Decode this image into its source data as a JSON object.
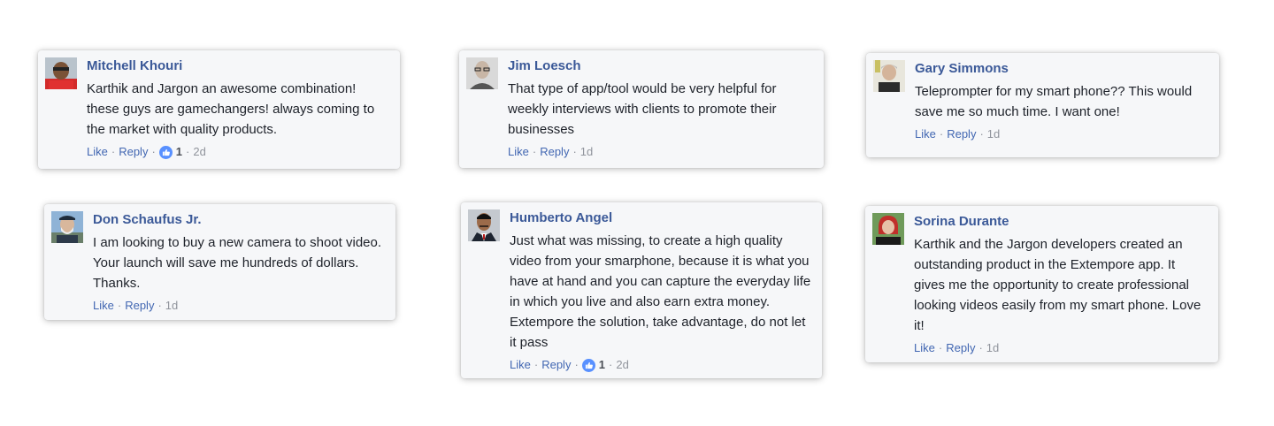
{
  "colors": {
    "name": "#3b5998",
    "link": "#4267b2",
    "meta": "#90949c",
    "like_badge": "#5890ff",
    "card_bg": "#f6f7f9"
  },
  "labels": {
    "like": "Like",
    "reply": "Reply",
    "sep": "·"
  },
  "comments": [
    {
      "name": "Mitchell Khouri",
      "text": "Karthik and Jargon an awesome combination! these guys are gamechangers! always coming to the market with quality products.",
      "likes": "1",
      "time": "2d",
      "avatar_icon": "avatar-red-shirt"
    },
    {
      "name": "Jim Loesch",
      "text": "That type of app/tool would be very helpful for weekly interviews with clients to promote their businesses",
      "likes": "",
      "time": "1d",
      "avatar_icon": "avatar-glasses"
    },
    {
      "name": "Gary Simmons",
      "text": "Teleprompter for my smart phone?? This would save me so much time. I want one!",
      "likes": "",
      "time": "1d",
      "avatar_icon": "avatar-grey-hair"
    },
    {
      "name": "Don Schaufus Jr.",
      "text": "I am looking to buy a new camera to shoot video. Your launch will save me hundreds of dollars. Thanks.",
      "likes": "",
      "time": "1d",
      "avatar_icon": "avatar-beard-cap"
    },
    {
      "name": "Humberto Angel",
      "text": "Just what was missing, to create a high quality video from your smarphone, because it is what you have at hand and you can capture the everyday life in which you live and also earn extra money. Extempore the solution, take advantage, do not let it pass",
      "likes": "1",
      "time": "2d",
      "avatar_icon": "avatar-suit"
    },
    {
      "name": "Sorina Durante",
      "text": "Karthik and the Jargon developers created an outstanding product in the Extempore app. It gives me the opportunity to create professional looking videos easily from my smart phone. Love it!",
      "likes": "",
      "time": "1d",
      "avatar_icon": "avatar-red-hair"
    }
  ]
}
